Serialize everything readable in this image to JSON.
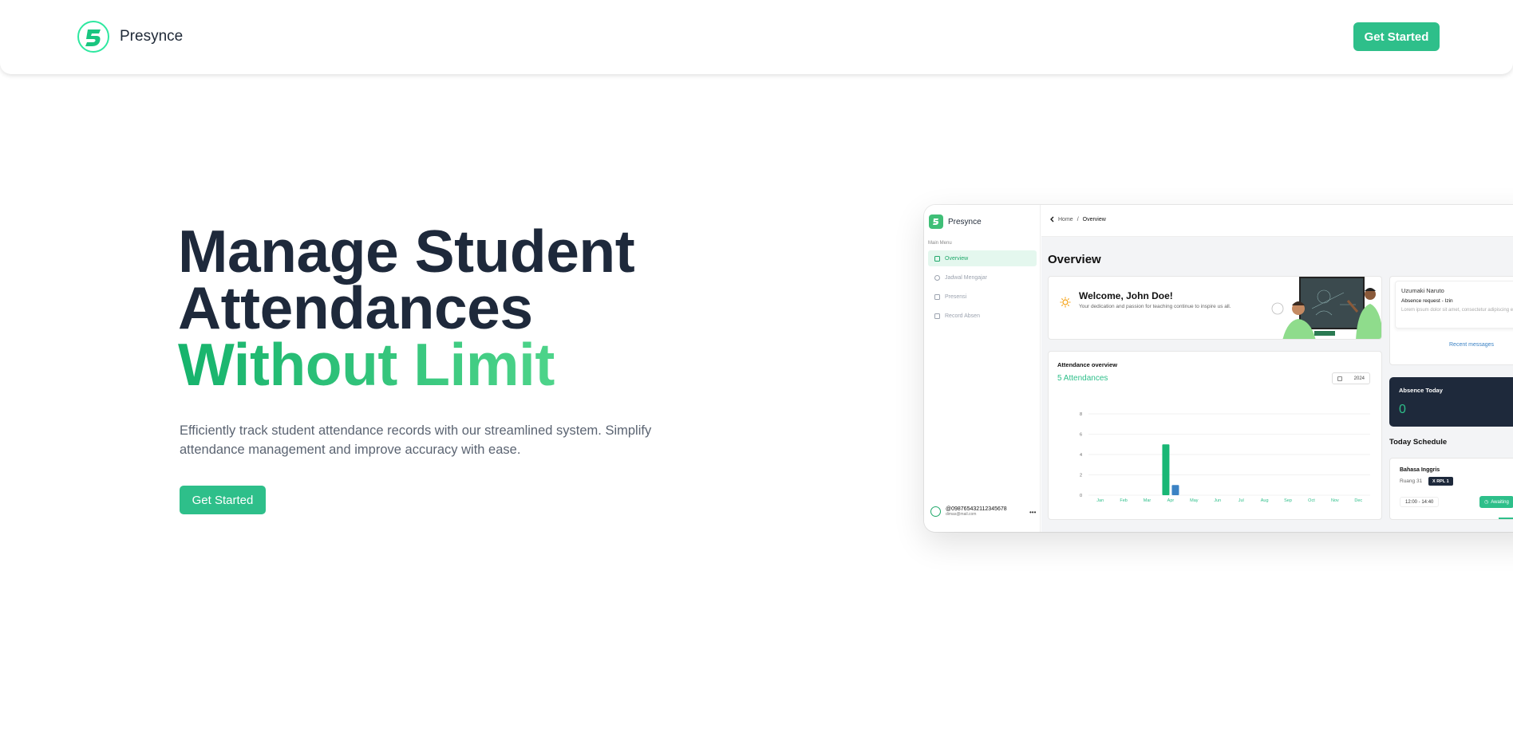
{
  "brand": {
    "name": "Presynce"
  },
  "nav": {
    "cta_label": "Get Started"
  },
  "hero": {
    "title_line1": "Manage Student",
    "title_line2": "Attendances",
    "title_line3": "Without Limit",
    "subtitle": "Efficiently track student attendance records with our streamlined system. Simplify attendance management and improve accuracy with ease.",
    "cta_label": "Get Started"
  },
  "colors": {
    "brand_green": "#2ebf8a",
    "heading": "#1e293b",
    "dark_card": "#1e293b",
    "bar_secondary": "#3b82c4"
  },
  "preview": {
    "brand": "Presynce",
    "menu_title": "Main Menu",
    "menu": [
      {
        "label": "Overview",
        "icon": "overview-icon",
        "active": true
      },
      {
        "label": "Jadwal Mengajar",
        "icon": "clock-icon",
        "active": false
      },
      {
        "label": "Presensi",
        "icon": "check-icon",
        "active": false
      },
      {
        "label": "Record Absen",
        "icon": "record-icon",
        "active": false
      }
    ],
    "user": {
      "id": "@098765432112345678",
      "email": "dimas@mail.com"
    },
    "breadcrumb": {
      "home": "Home",
      "sep": "/",
      "current": "Overview"
    },
    "page_title": "Overview",
    "welcome": {
      "title": "Welcome, John Doe!",
      "subtitle": "Your dedication and passion for teaching continue to inspire us all."
    },
    "attendance": {
      "title": "Attendance overview",
      "count_label": "5 Attendances",
      "year": "2024"
    },
    "message": {
      "name": "Uzumaki Naruto",
      "subject": "Absence request - Izin",
      "body": "Lorem ipsum dolor sit amet, consectetur adipiscing elit. Praesent sit amet laoreet tortor. M",
      "link": "Recent messages"
    },
    "absence": {
      "title": "Absence Today",
      "value": "0"
    },
    "schedule": {
      "title": "Today Schedule",
      "subject": "Bahasa Inggris",
      "room": "Ruang 31",
      "class": "X RPL 1",
      "time": "12:00 - 14:40",
      "button": "Awaiting"
    }
  },
  "chart_data": {
    "type": "bar",
    "title": "Attendance overview",
    "categories": [
      "Jan",
      "Feb",
      "Mar",
      "Apr",
      "May",
      "Jun",
      "Jul",
      "Aug",
      "Sep",
      "Oct",
      "Nov",
      "Dec"
    ],
    "series": [
      {
        "values": [
          0,
          0,
          0,
          5,
          0,
          0,
          0,
          0,
          0,
          0,
          0,
          0
        ],
        "color": "#19b775"
      },
      {
        "values": [
          0,
          0,
          0,
          1,
          0,
          0,
          0,
          0,
          0,
          0,
          0,
          0
        ],
        "color": "#3b82c4"
      }
    ],
    "yticks": [
      0,
      2,
      4,
      6,
      8
    ],
    "ylim": [
      0,
      8
    ],
    "grid": true
  }
}
